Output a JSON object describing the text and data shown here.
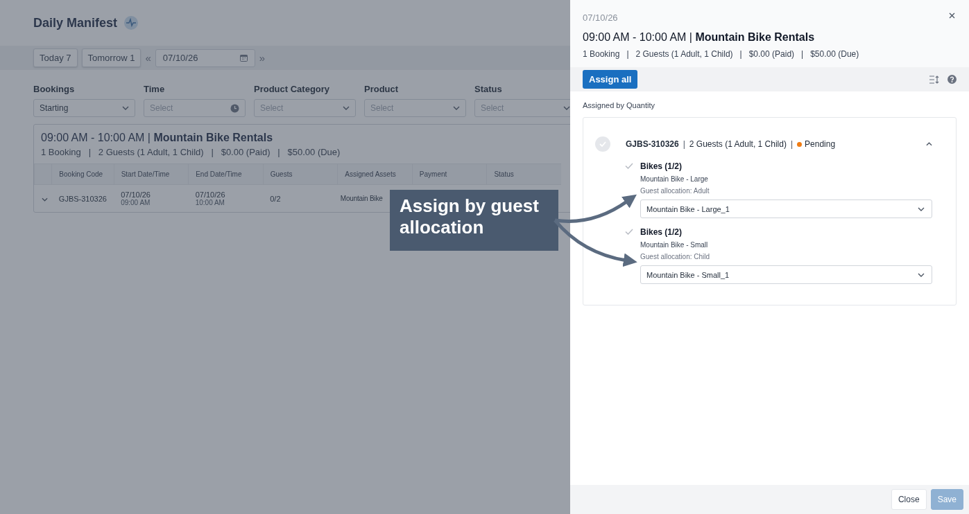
{
  "page": {
    "title": "Daily Manifest",
    "date_buttons": [
      {
        "label": "Today 7"
      },
      {
        "label": "Tomorrow 1"
      }
    ],
    "prev_label": "«",
    "next_label": "»",
    "date_field": {
      "value": "07/10/26"
    },
    "filters": [
      {
        "label": "Bookings",
        "value": "Starting",
        "kind": "select"
      },
      {
        "label": "Time",
        "placeholder": "Select",
        "kind": "time"
      },
      {
        "label": "Product Category",
        "placeholder": "Select",
        "kind": "select"
      },
      {
        "label": "Product",
        "placeholder": "Select",
        "kind": "select"
      },
      {
        "label": "Status",
        "placeholder": "Select",
        "kind": "select"
      }
    ],
    "group": {
      "title": "09:00 AM - 10:00 AM | **Mountain Bike Rentals**",
      "summary": "1 Booking   |   2 Guests (1 Adult, 1 Child)   |   $0.00 (Paid)   |   $50.00 (Due)",
      "table": {
        "columns": [
          "Booking Code",
          "Start Date/Time",
          "End Date/Time",
          "Guests",
          "Assigned Assets",
          "Payment",
          "Status"
        ],
        "rows": [
          {
            "expanded": false,
            "code": "GJBS-310326",
            "start": {
              "date": "07/10/26",
              "time": "09:00 AM"
            },
            "end": {
              "date": "07/10/26",
              "time": "10:00 AM"
            },
            "guests": "0/2",
            "assets": "Mountain Bike"
          }
        ]
      }
    }
  },
  "drawer": {
    "date": "07/10/26",
    "title": "09:00 AM - 10:00 AM | **Mountain Bike Rentals**",
    "summary": "1 Booking   |   2 Guests (1 Adult, 1 Child)   |   $0.00 (Paid)   |   $50.00 (Due)",
    "assign_button": "Assign all",
    "section_label": "Assigned by Quantity",
    "booking": {
      "code": "GJBS-310326",
      "separator": "|",
      "guests": "2 Guests (1 Adult, 1 Child)",
      "status": "Pending",
      "color": "#f07c13",
      "expanded": true,
      "items": [
        {
          "title": "Bikes (1/2)",
          "product": "Mountain Bike - Large",
          "allocation": "Guest allocation: Adult",
          "value": "Mountain Bike - Large_1"
        },
        {
          "title": "Bikes (1/2)",
          "product": "Mountain Bike - Small",
          "allocation": "Guest allocation: Child",
          "value": "Mountain Bike - Small_1"
        }
      ]
    },
    "footer_buttons": [
      {
        "label": "Close",
        "disabled": false
      },
      {
        "label": "Save",
        "disabled": true
      }
    ]
  },
  "callout": {
    "text": "Assign by guest allocation"
  }
}
